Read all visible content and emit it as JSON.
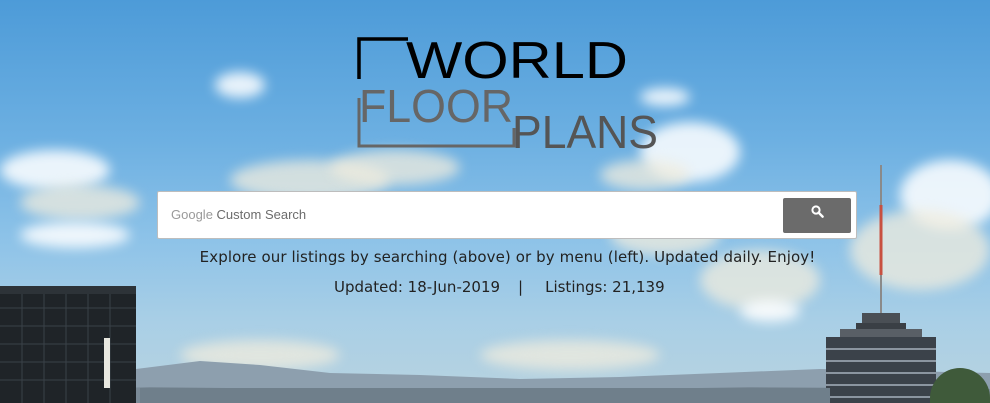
{
  "logo": {
    "line1": "WORLD",
    "line2": "FLOOR",
    "line3": "PLANS"
  },
  "search": {
    "brand": "Google",
    "placeholder": "Custom Search",
    "button_icon": "search-icon"
  },
  "tagline": "Explore our listings by searching (above) or by menu (left). Updated daily. Enjoy!",
  "stats": {
    "updated": "Updated: 18-Jun-2019",
    "separator": "|",
    "listings": "Listings: 21,139"
  },
  "colors": {
    "sky": "#5fa6dc",
    "logo_dark": "#000000",
    "logo_gray": "#666666",
    "button": "#6b6b6b"
  }
}
